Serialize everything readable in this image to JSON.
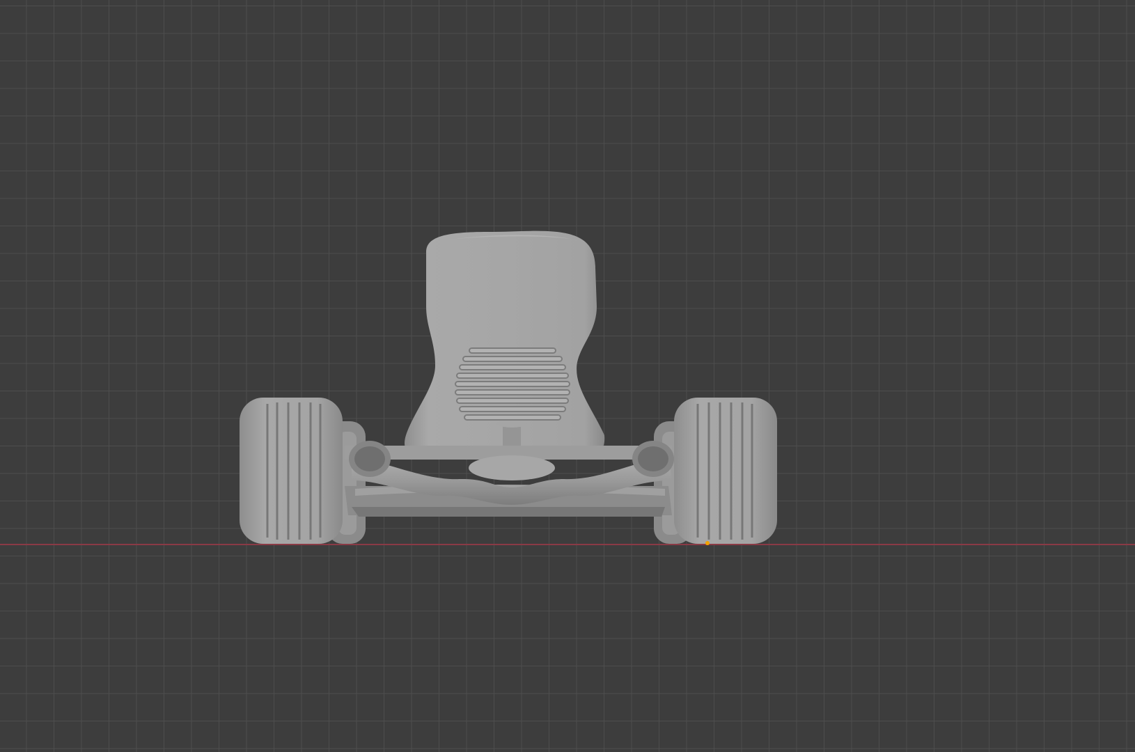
{
  "viewport": {
    "grid_color": "#505050",
    "background_color": "#3d3d3d",
    "x_axis_color": "#8a3a45",
    "origin_color": "#f2a300"
  },
  "scene": {
    "object": "go-kart-model",
    "shading": "solid-gray"
  }
}
